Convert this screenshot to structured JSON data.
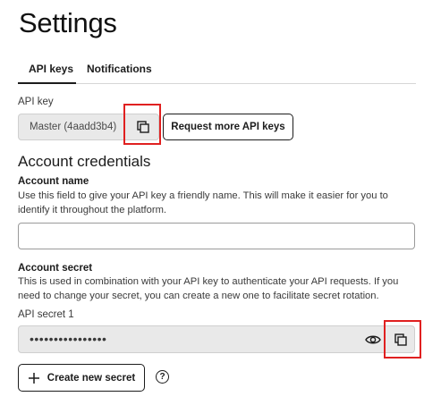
{
  "page": {
    "title": "Settings"
  },
  "tabs": [
    {
      "label": "API keys",
      "active": true
    },
    {
      "label": "Notifications",
      "active": false
    }
  ],
  "api_key": {
    "label": "API key",
    "value": "Master (4aadd3b4)",
    "copy_icon": "copy-icon",
    "request_button": "Request more API keys"
  },
  "account_credentials": {
    "heading": "Account credentials",
    "account_name": {
      "label": "Account name",
      "description": "Use this field to give your API key a friendly name. This will make it easier for you to identify it throughout the platform.",
      "value": ""
    },
    "account_secret": {
      "label": "Account secret",
      "description": "This is used in combination with your API key to authenticate your API requests. If you need to change your secret, you can create a new one to facilitate secret rotation.",
      "secret_label": "API secret 1",
      "secret_value": "••••••••••••••••",
      "show_icon": "eye-icon",
      "copy_icon": "copy-icon"
    },
    "create_button": "Create new secret",
    "help_icon": "question-circle-icon",
    "help_glyph": "?"
  },
  "colors": {
    "highlight": "#e02020",
    "field_bg": "#e9e9e9",
    "text": "#1c1c1c"
  }
}
